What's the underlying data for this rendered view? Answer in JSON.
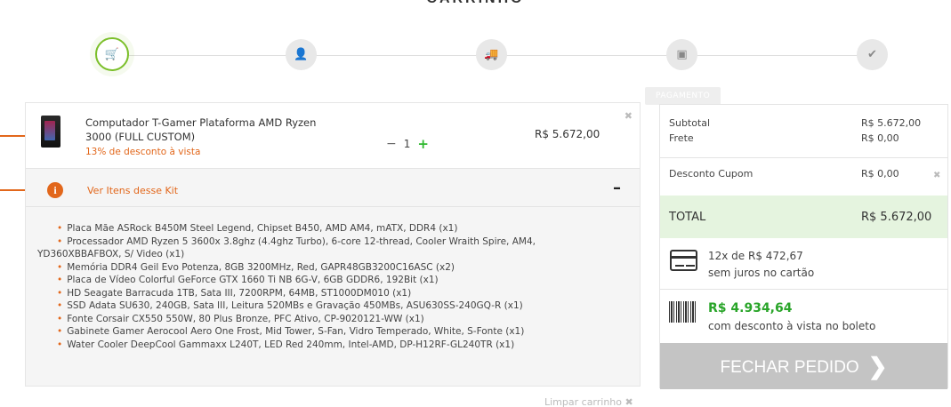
{
  "page": {
    "title": "CARRINHO"
  },
  "stepper": {
    "steps": [
      {
        "name": "cart",
        "icon": "cart-icon",
        "glyph": "🛒"
      },
      {
        "name": "user",
        "icon": "user-icon",
        "glyph": "👤"
      },
      {
        "name": "shipping",
        "icon": "truck-icon",
        "glyph": "🚚"
      },
      {
        "name": "payment",
        "icon": "money-icon",
        "glyph": "▣"
      },
      {
        "name": "confirm",
        "icon": "check-icon",
        "glyph": "✔"
      }
    ],
    "payment_label": "PAGAMENTO"
  },
  "cart": {
    "item": {
      "name": "Computador T-Gamer Plataforma AMD Ryzen 3000 (FULL CUSTOM)",
      "discount": "13% de desconto à vista",
      "quantity": "1",
      "minus": "−",
      "plus": "+",
      "price": "R$ 5.672,00",
      "remove": "✖"
    },
    "kit": {
      "info_glyph": "i",
      "link": "Ver Itens desse Kit",
      "collapse": "–",
      "items": [
        "Placa Mãe ASRock B450M Steel Legend, Chipset B450, AMD AM4, mATX, DDR4 (x1)",
        "Processador AMD Ryzen 5 3600x 3.8ghz (4.4ghz Turbo), 6-core 12-thread, Cooler Wraith Spire, AM4, YD360XBBAFBOX, S/ Video (x1)",
        "Memória DDR4 Geil Evo Potenza, 8GB 3200MHz, Red, GAPR48GB3200C16ASC (x2)",
        "Placa de Vídeo Colorful GeForce GTX 1660 Ti NB 6G-V, 6GB GDDR6, 192Bit (x1)",
        "HD Seagate Barracuda 1TB, Sata III, 7200RPM, 64MB, ST1000DM010 (x1)",
        "SSD Adata SU630, 240GB, Sata III, Leitura 520MBs e Gravação 450MBs, ASU630SS-240GQ-R (x1)",
        "Fonte Corsair CX550 550W, 80 Plus Bronze, PFC Ativo, CP-9020121-WW (x1)",
        "Gabinete Gamer Aerocool Aero One Frost, Mid Tower, S-Fan, Vidro Temperado, White, S-Fonte (x1)",
        "Water Cooler DeepCool Gammaxx L240T, LED Red 240mm, Intel-AMD, DP-H12RF-GL240TR (x1)"
      ]
    },
    "clear": "Limpar carrinho ✖"
  },
  "summary": {
    "subtotal_label": "Subtotal",
    "subtotal_value": "R$ 5.672,00",
    "frete_label": "Frete",
    "frete_value": "R$ 0,00",
    "cupom_label": "Desconto Cupom",
    "cupom_value": "R$ 0,00",
    "cupom_remove": "✖",
    "total_label": "TOTAL",
    "total_value": "R$ 5.672,00",
    "installments_line1": "12x de R$ 472,67",
    "installments_line2": "sem juros no cartão",
    "boleto_price": "R$ 4.934,64",
    "boleto_desc": "com desconto à vista no boleto",
    "checkout_label": "FECHAR PEDIDO",
    "checkout_chevron": "❯"
  },
  "colors": {
    "accent_orange": "#e2671b",
    "accent_green": "#2aa52a",
    "step_active_border": "#7bbf2a",
    "total_bg": "#e5f4df",
    "button_disabled": "#c4c4c4"
  }
}
